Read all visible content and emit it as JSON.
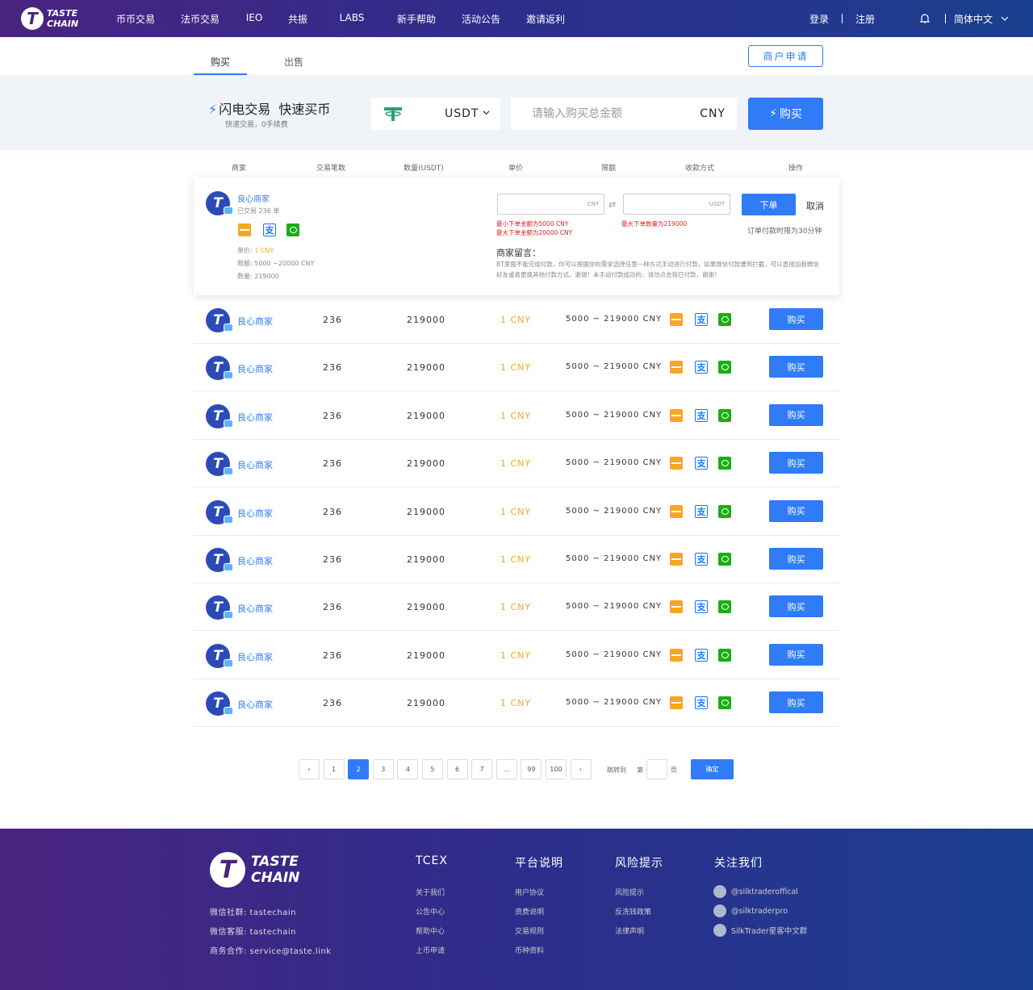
{
  "header": {
    "logo_line1": "TASTE",
    "logo_line2": "CHAIN",
    "nav": [
      "币币交易",
      "法币交易",
      "IEO",
      "共振",
      "LABS",
      "新手帮助",
      "活动公告",
      "邀请返利"
    ],
    "login": "登录",
    "register": "注册",
    "language": "简体中文"
  },
  "tabs": {
    "buy": "购买",
    "sell": "出售",
    "merchant_apply": "商户申请"
  },
  "quick": {
    "title1": "闪电交易",
    "title2": "快速买币",
    "subtitle": "快速交易，0手续费",
    "coin": "USDT",
    "amount_placeholder": "请输入购买总金额",
    "unit": "CNY",
    "buy_label": "购买"
  },
  "columns": [
    "商家",
    "交易笔数",
    "数量(USDT)",
    "单价",
    "限额",
    "收款方式",
    "操作"
  ],
  "expanded": {
    "merchant": "良心商家",
    "trades": "已交易 236 单",
    "price_label": "单价:",
    "price": "1 CNY",
    "limit": "限额:  5000 ~20000 CNY",
    "quantity": "数量:  219000",
    "cny_unit": "CNY",
    "usdt_unit": "USDT",
    "min_warn": "最小下单金额为5000 CNY",
    "max_warn": "最大下单金额为20000 CNY",
    "qty_warn": "最大下单数量为219000",
    "order_btn": "下单",
    "cancel": "取消",
    "time_limit": "订单付款时限为30分钟",
    "msg_title": "商家留言：",
    "msg_body": "BT里面不能完成付款，你可以根据你的需求选择任意一种方式手动进行付款，如果微信付款遭到拦截，可以直接加我微信好友或者更换其他付款方式。谢谢！未手动付款成功的，请勿点击我已付款，谢谢！"
  },
  "rows": [
    {
      "merchant": "良心商家",
      "trades": "236",
      "qty": "219000",
      "price": "1 CNY",
      "limit": "5000 ~ 219000 CNY",
      "action": "购买"
    },
    {
      "merchant": "良心商家",
      "trades": "236",
      "qty": "219000",
      "price": "1 CNY",
      "limit": "5000 ~ 219000 CNY",
      "action": "购买"
    },
    {
      "merchant": "良心商家",
      "trades": "236",
      "qty": "219000",
      "price": "1 CNY",
      "limit": "5000 ~ 219000 CNY",
      "action": "购买"
    },
    {
      "merchant": "良心商家",
      "trades": "236",
      "qty": "219000",
      "price": "1 CNY",
      "limit": "5000 ~ 219000 CNY",
      "action": "购买"
    },
    {
      "merchant": "良心商家",
      "trades": "236",
      "qty": "219000",
      "price": "1 CNY",
      "limit": "5000 ~ 219000 CNY",
      "action": "购买"
    },
    {
      "merchant": "良心商家",
      "trades": "236",
      "qty": "219000",
      "price": "1 CNY",
      "limit": "5000 ~ 219000 CNY",
      "action": "购买"
    },
    {
      "merchant": "良心商家",
      "trades": "236",
      "qty": "219000",
      "price": "1 CNY",
      "limit": "5000 ~ 219000 CNY",
      "action": "购买"
    },
    {
      "merchant": "良心商家",
      "trades": "236",
      "qty": "219000",
      "price": "1 CNY",
      "limit": "5000 ~ 219000 CNY",
      "action": "购买"
    },
    {
      "merchant": "良心商家",
      "trades": "236",
      "qty": "219000",
      "price": "1 CNY",
      "limit": "5000 ~ 219000 CNY",
      "action": "购买"
    }
  ],
  "pagination": {
    "pages": [
      "1",
      "2",
      "3",
      "4",
      "5",
      "6",
      "7",
      "...",
      "99",
      "100"
    ],
    "current": "2",
    "jump_to": "跳转到",
    "page_prefix": "第",
    "page_suffix": "页",
    "confirm": "确定"
  },
  "footer": {
    "wechat_group": "微信社群:  tastechain",
    "wechat_service": "微信客服:  tastechain",
    "business": "商务合作:  service@taste.link",
    "cols": [
      {
        "title": "TCEX",
        "links": [
          "关于我们",
          "公告中心",
          "帮助中心",
          "上币申请"
        ]
      },
      {
        "title": "平台说明",
        "links": [
          "用户协议",
          "资费说明",
          "交易规则",
          "币种资料"
        ]
      },
      {
        "title": "风险提示",
        "links": [
          "风险提示",
          "反洗钱政策",
          "法律声明"
        ]
      }
    ],
    "follow_title": "关注我们",
    "social": [
      "@silktraderoffical",
      "@silktraderpro",
      "SilkTrader星客中文群"
    ]
  },
  "colors": {
    "accent": "#2f7cf6",
    "price": "#f5a623",
    "warn": "#e02020"
  }
}
